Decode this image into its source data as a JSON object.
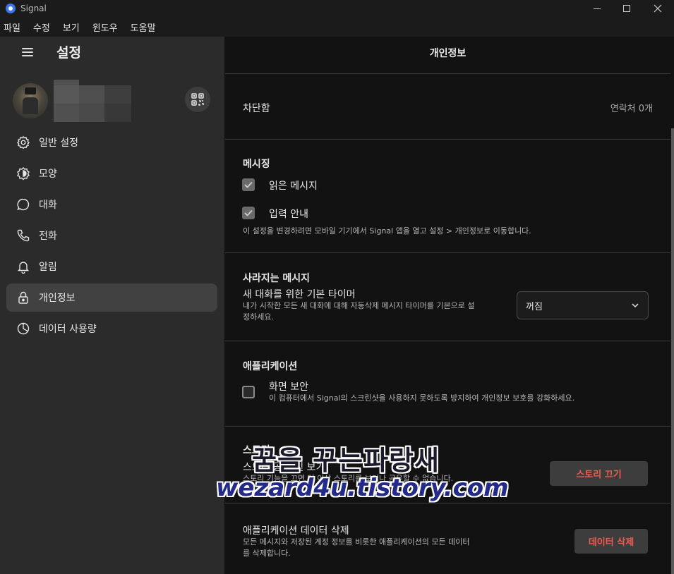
{
  "window": {
    "title": "Signal"
  },
  "menubar": [
    "파일",
    "수정",
    "보기",
    "윈도우",
    "도움말"
  ],
  "sidebar": {
    "title": "설정",
    "items": [
      {
        "label": "일반 설정",
        "icon": "gear-icon"
      },
      {
        "label": "모양",
        "icon": "appearance-icon"
      },
      {
        "label": "대화",
        "icon": "chat-icon"
      },
      {
        "label": "전화",
        "icon": "phone-icon"
      },
      {
        "label": "알림",
        "icon": "bell-icon"
      },
      {
        "label": "개인정보",
        "icon": "lock-icon",
        "active": true
      },
      {
        "label": "데이터 사용량",
        "icon": "pie-chart-icon"
      }
    ]
  },
  "main": {
    "title": "개인정보",
    "blocked": {
      "label": "차단함",
      "value": "연락처 0개"
    },
    "messaging": {
      "heading": "메시징",
      "read_receipts": {
        "label": "읽은 메시지",
        "checked": true
      },
      "typing": {
        "label": "입력 안내",
        "checked": true
      },
      "note": "이 설정을 변경하려면 모바일 기기에서 Signal 앱을 열고 설정 > 개인정보로 이동합니다."
    },
    "disappearing": {
      "heading": "사라지는 메시지",
      "label": "새 대화를 위한 기본 타이머",
      "desc_line1": "내가 시작한 모든 새 대화에 대해 자동삭제 메시지 타이머를 기본으로 설",
      "desc_line2": "정하세요.",
      "select_value": "꺼짐"
    },
    "application": {
      "heading": "애플리케이션",
      "screen_security": {
        "label": "화면 보안",
        "checked": false,
        "desc": "이 컴퓨터에서 Signal의 스크린샷을 사용하지 못하도록 방지하여 개인정보 보호를 강화하세요."
      }
    },
    "stories": {
      "heading": "스토리",
      "label": "스토리 공유 및 보기",
      "desc": "스토리 기능을 끄면 더 이상 스토리를 보거나 공유할 수 없습니다.",
      "button": "스토리 끄기"
    },
    "delete_data": {
      "label": "애플리케이션 데이터 삭제",
      "desc_line1": "모든 메시지와 저장된 계정 정보를 비롯한 애플리케이션의 모든 데이터",
      "desc_line2": "를 삭제합니다.",
      "button": "데이터 삭제"
    }
  },
  "watermark": {
    "line1": "꿈을 꾸는파랑새",
    "line2": "wezard4u.tistory.com"
  },
  "colors": {
    "accent": "#3a76f0",
    "danger": "#f15a4e",
    "sidebar_bg": "#2b2b2b",
    "main_bg": "#121212"
  }
}
